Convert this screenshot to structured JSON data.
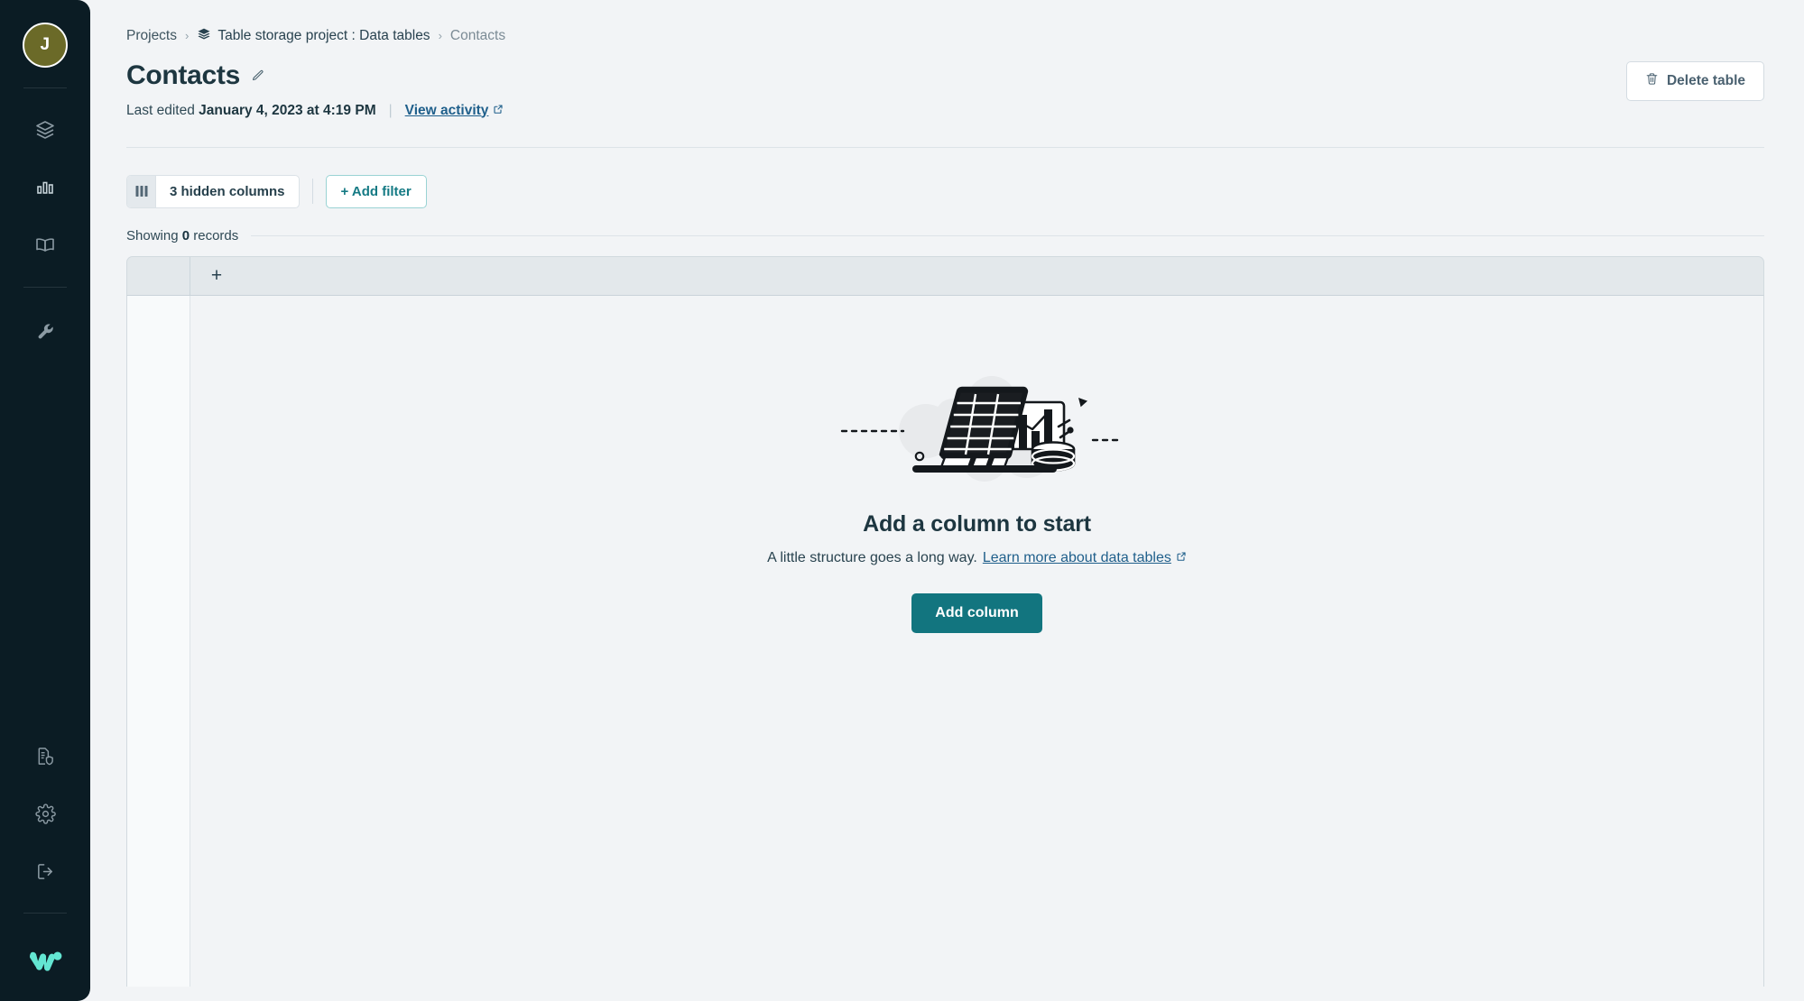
{
  "sidebar": {
    "avatar_initial": "J",
    "nav_items": [
      {
        "name": "data-tables",
        "icon": "layers-icon"
      },
      {
        "name": "analytics",
        "icon": "bar-chart-icon",
        "active": true
      },
      {
        "name": "docs",
        "icon": "book-icon"
      }
    ],
    "tools_items": [
      {
        "name": "tools",
        "icon": "wrench-icon"
      }
    ],
    "bottom_items": [
      {
        "name": "reports",
        "icon": "document-shield-icon"
      },
      {
        "name": "settings",
        "icon": "gear-icon"
      },
      {
        "name": "logout",
        "icon": "logout-icon"
      }
    ],
    "logo_name": "brand-logo"
  },
  "breadcrumb": {
    "projects": "Projects",
    "project": "Table storage project : Data tables",
    "current": "Contacts",
    "separator": "›"
  },
  "header": {
    "title": "Contacts",
    "last_edited_prefix": "Last edited",
    "last_edited_date": "January 4, 2023 at 4:19 PM",
    "view_activity": "View activity",
    "delete_table": "Delete table"
  },
  "toolbar": {
    "hidden_columns": "3 hidden columns",
    "add_filter": "+ Add filter"
  },
  "records": {
    "showing_prefix": "Showing",
    "count": "0",
    "showing_suffix": "records"
  },
  "table": {
    "add_column_plus": "+"
  },
  "empty_state": {
    "title": "Add a column to start",
    "subtitle": "A little structure goes a long way.",
    "link": "Learn more about data tables",
    "button": "Add column"
  },
  "colors": {
    "sidebar_bg": "#0b1c24",
    "page_bg": "#f2f4f6",
    "accent_teal": "#12757f",
    "link_blue": "#1f5f8b",
    "logo_teal": "#63e6d2",
    "avatar_olive": "#6b6a28",
    "title_ink": "#1d3640"
  }
}
